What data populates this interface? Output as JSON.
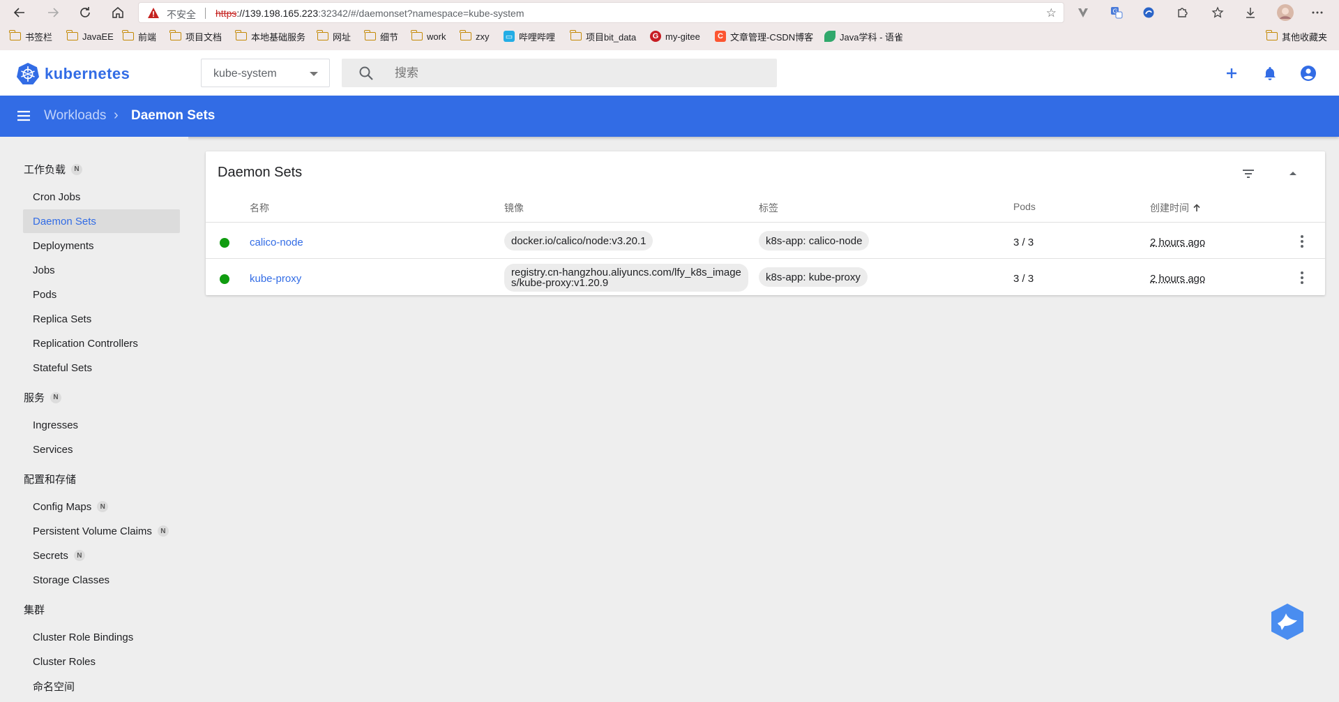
{
  "browser": {
    "insecure_label": "不安全",
    "url_proto": "https",
    "url_host": "://139.198.165.223",
    "url_rest": ":32342/#/daemonset?namespace=kube-system",
    "bookmarks": [
      {
        "label": "书签栏",
        "icon": "folder-icon"
      },
      {
        "label": "JavaEE",
        "icon": "folder-icon"
      },
      {
        "label": "前端",
        "icon": "folder-icon"
      },
      {
        "label": "项目文档",
        "icon": "folder-icon"
      },
      {
        "label": "本地基础服务",
        "icon": "folder-icon"
      },
      {
        "label": "网址",
        "icon": "folder-icon"
      },
      {
        "label": "细节",
        "icon": "folder-icon"
      },
      {
        "label": "work",
        "icon": "folder-icon"
      },
      {
        "label": "zxy",
        "icon": "folder-icon"
      },
      {
        "label": "哔哩哔哩",
        "icon": "bilibili-icon"
      },
      {
        "label": "项目bit_data",
        "icon": "folder-icon"
      },
      {
        "label": "my-gitee",
        "icon": "gitee-icon"
      },
      {
        "label": "文章管理-CSDN博客",
        "icon": "csdn-icon"
      },
      {
        "label": "Java学科 - 语雀",
        "icon": "yuque-icon"
      }
    ],
    "other_bookmarks": "其他收藏夹"
  },
  "header": {
    "brand": "kubernetes",
    "namespace": "kube-system",
    "search_placeholder": "搜索"
  },
  "breadcrumb": {
    "parent": "Workloads",
    "separator": "›",
    "current": "Daemon Sets"
  },
  "sidebar": {
    "badge": "N",
    "sections": [
      {
        "title": "工作负载",
        "badge": true
      },
      {
        "title": "服务",
        "badge": true
      },
      {
        "title": "配置和存储",
        "badge": false
      },
      {
        "title": "集群",
        "badge": false
      }
    ],
    "workloads": [
      "Cron Jobs",
      "Daemon Sets",
      "Deployments",
      "Jobs",
      "Pods",
      "Replica Sets",
      "Replication Controllers",
      "Stateful Sets"
    ],
    "services": [
      "Ingresses",
      "Services"
    ],
    "config": [
      "Config Maps",
      "Persistent Volume Claims",
      "Secrets",
      "Storage Classes"
    ],
    "cluster": [
      "Cluster Role Bindings",
      "Cluster Roles",
      "命名空间"
    ],
    "active": "Daemon Sets"
  },
  "card": {
    "title": "Daemon Sets",
    "columns": {
      "name": "名称",
      "image": "镜像",
      "labels": "标签",
      "pods": "Pods",
      "created": "创建时间"
    },
    "rows": [
      {
        "status": "running",
        "name": "calico-node",
        "image_line1": "docker.io/calico/node:v3.20.1",
        "image_line2": "",
        "label": "k8s-app: calico-node",
        "pods": "3 / 3",
        "created": "2 hours ago"
      },
      {
        "status": "running",
        "name": "kube-proxy",
        "image_line1": "registry.cn-hangzhou.aliyuncs.com/lfy_k8s_image",
        "image_line2": "s/kube-proxy:v1.20.9",
        "label": "k8s-app: kube-proxy",
        "pods": "3 / 3",
        "created": "2 hours ago"
      }
    ]
  },
  "colors": {
    "primary": "#326ce5",
    "running": "#109c10"
  }
}
